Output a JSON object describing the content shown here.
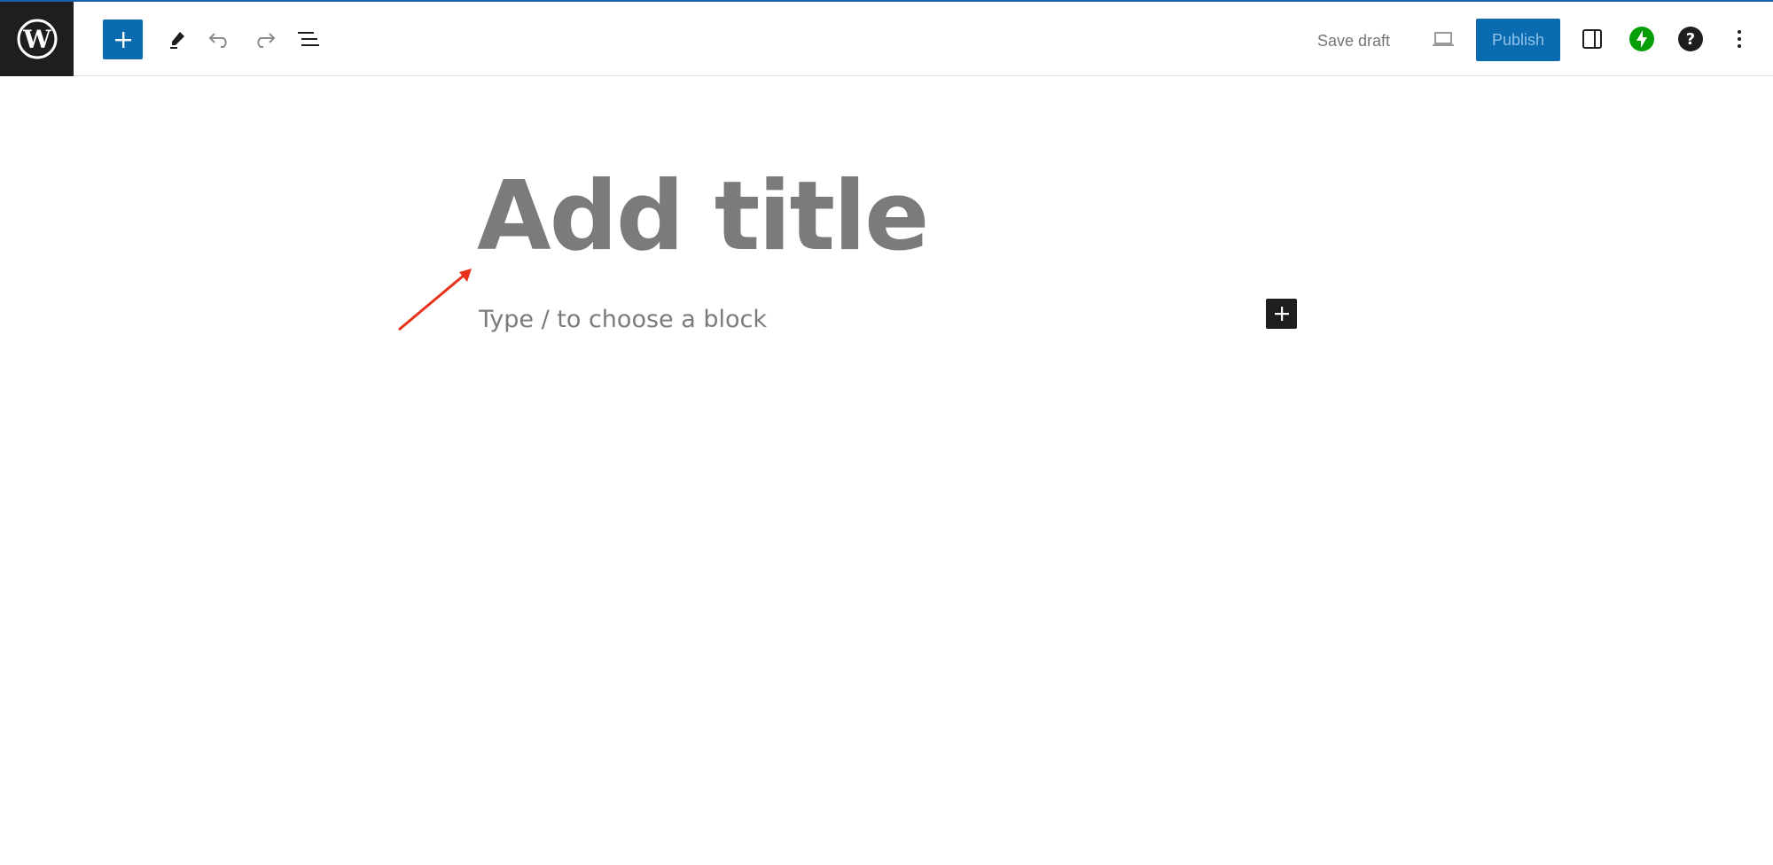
{
  "toolbar": {
    "save_draft_label": "Save draft",
    "publish_label": "Publish",
    "accent_color": "#0b6bb1",
    "icons": {
      "logo": "wordpress-logo-icon",
      "inserter": "plus-icon",
      "tools": "pencil-icon",
      "undo": "undo-icon",
      "redo": "redo-icon",
      "document_overview": "list-view-icon",
      "preview": "laptop-preview-icon",
      "settings": "sidebar-toggle-icon",
      "jetpack": "jetpack-bolt-icon",
      "help": "help-question-icon",
      "options": "vertical-ellipsis-icon"
    }
  },
  "editor": {
    "title_placeholder": "Add title",
    "block_placeholder": "Type / to choose a block",
    "annotation_color": "#e8311a"
  }
}
